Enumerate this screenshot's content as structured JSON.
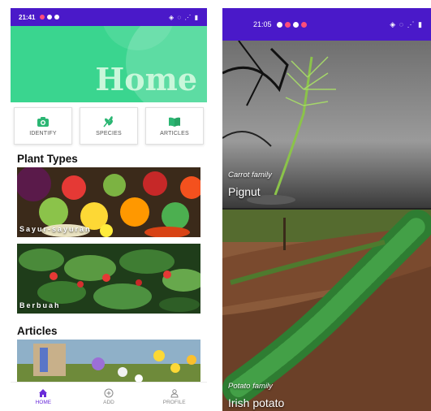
{
  "left_screen": {
    "status": {
      "time": "21:41"
    },
    "header": {
      "title": "Home"
    },
    "categories": [
      {
        "label": "IDENTIFY",
        "icon": "camera-icon"
      },
      {
        "label": "SPECIES",
        "icon": "leaf-icon"
      },
      {
        "label": "ARTICLES",
        "icon": "book-icon"
      }
    ],
    "plant_types": {
      "title": "Plant Types",
      "items": [
        {
          "label": "Sayur-sayuran"
        },
        {
          "label": "Berbuah"
        }
      ]
    },
    "articles": {
      "title": "Articles"
    },
    "bottom_nav": [
      {
        "label": "HOME",
        "icon": "home-icon",
        "active": true
      },
      {
        "label": "ADD",
        "icon": "add-circle-icon",
        "active": false
      },
      {
        "label": "PROFILE",
        "icon": "person-icon",
        "active": false
      }
    ],
    "colors": {
      "primary": "#4a19c9",
      "header": "#3ad58f",
      "accent": "#6a2bd9"
    }
  },
  "right_screen": {
    "status": {
      "time": "21:05"
    },
    "plants": [
      {
        "family": "Carrot family",
        "name": "Pignut"
      },
      {
        "family": "Potato family",
        "name": "Irish potato"
      }
    ]
  }
}
